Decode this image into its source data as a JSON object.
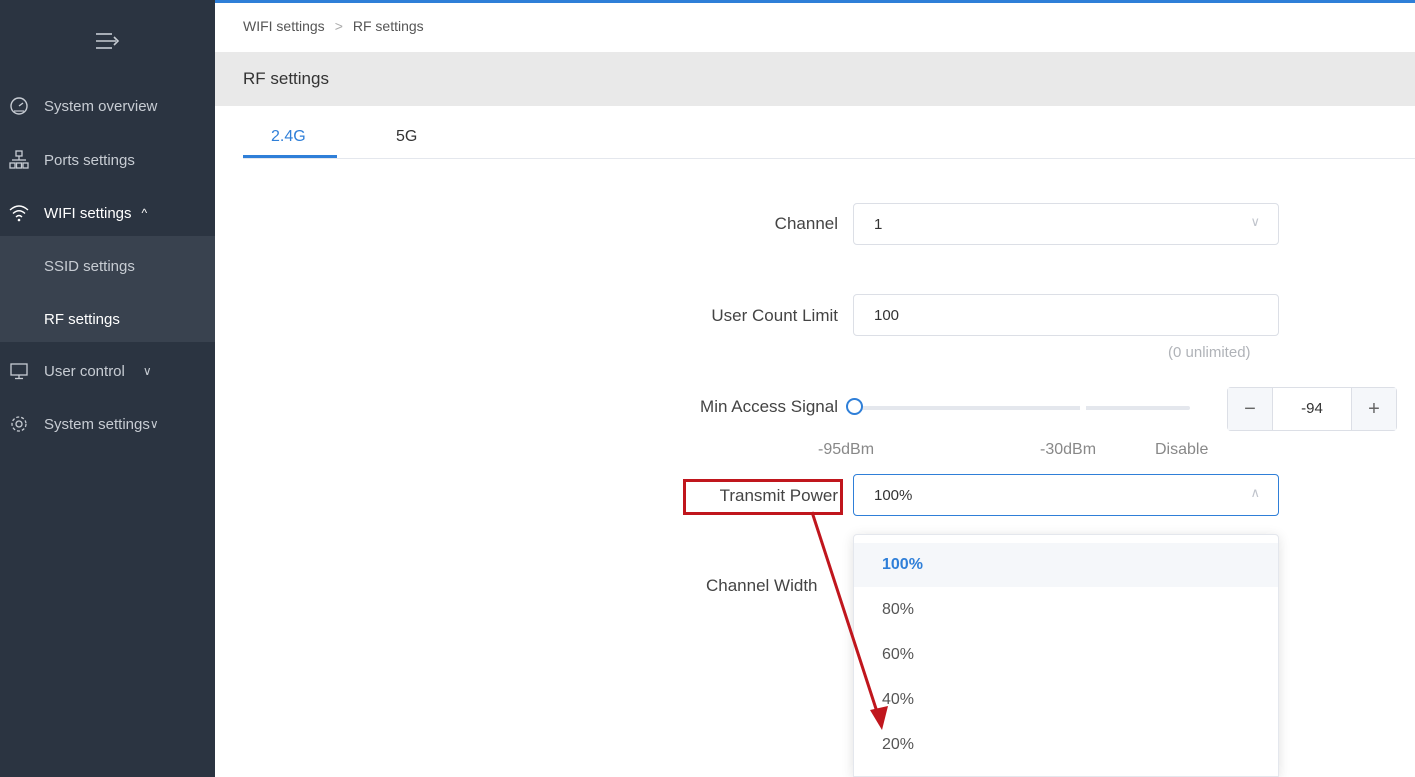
{
  "breadcrumb": {
    "parent": "WIFI settings",
    "separator": ">",
    "current": "RF settings"
  },
  "page_title": "RF settings",
  "tabs": [
    {
      "label": "2.4G",
      "active": true
    },
    {
      "label": "5G",
      "active": false
    }
  ],
  "sidebar": {
    "items": [
      {
        "label": "System overview",
        "icon": "gauge-icon"
      },
      {
        "label": "Ports settings",
        "icon": "network-icon"
      },
      {
        "label": "WIFI settings",
        "icon": "wifi-icon",
        "expanded": true,
        "chevron": "^"
      },
      {
        "label": "User control",
        "icon": "monitor-icon",
        "chevron": "∨"
      },
      {
        "label": "System settings",
        "icon": "gear-icon",
        "chevron": "∨"
      }
    ],
    "submenu": [
      {
        "label": "SSID settings"
      },
      {
        "label": "RF settings",
        "active": true
      }
    ]
  },
  "form": {
    "channel": {
      "label": "Channel",
      "value": "1"
    },
    "user_count_limit": {
      "label": "User Count Limit",
      "value": "100",
      "hint": "(0 unlimited)"
    },
    "min_access_signal": {
      "label": "Min Access Signal",
      "value": "-94",
      "ticks": [
        "-95dBm",
        "-30dBm",
        "Disable"
      ],
      "minus": "−",
      "plus": "+"
    },
    "transmit_power": {
      "label": "Transmit Power",
      "value": "100%",
      "options": [
        "100%",
        "80%",
        "60%",
        "40%",
        "20%"
      ]
    },
    "channel_width": {
      "label": "Channel Width"
    }
  },
  "colors": {
    "sidebar_bg": "#2b3441",
    "accent": "#2f7fd8",
    "annotation_red": "#c0161d"
  }
}
